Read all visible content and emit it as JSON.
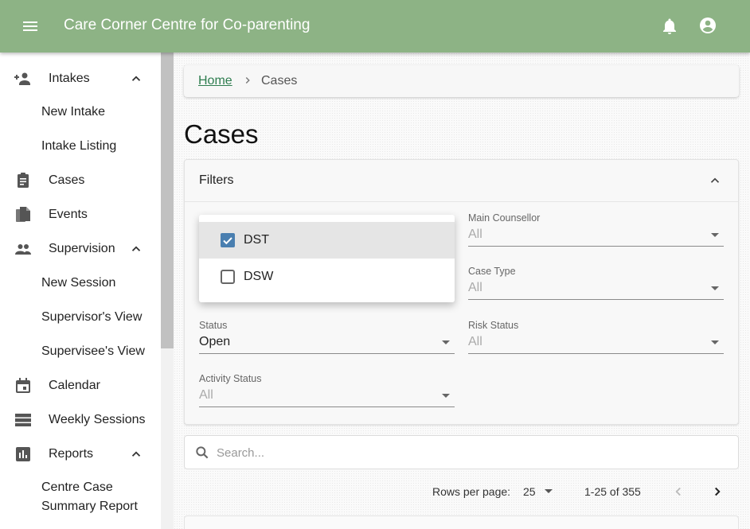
{
  "app": {
    "title": "Care Corner Centre for Co-parenting"
  },
  "icons": {
    "menu": "menu-icon",
    "notifications": "bell-icon",
    "account": "account-circle-icon",
    "search": "search-icon"
  },
  "colors": {
    "header": "#8db385",
    "link": "#2e7d4f"
  },
  "sidebar": {
    "items": [
      {
        "label": "Intakes",
        "icon": "person-add-icon",
        "expanded": true
      },
      {
        "label": "New Intake"
      },
      {
        "label": "Intake Listing"
      },
      {
        "label": "Cases",
        "icon": "clipboard-icon"
      },
      {
        "label": "Events",
        "icon": "file-copy-icon"
      },
      {
        "label": "Supervision",
        "icon": "people-icon",
        "expanded": true
      },
      {
        "label": "New Session"
      },
      {
        "label": "Supervisor's View"
      },
      {
        "label": "Supervisee's View"
      },
      {
        "label": "Calendar",
        "icon": "calendar-icon"
      },
      {
        "label": "Weekly Sessions",
        "icon": "view-week-icon"
      },
      {
        "label": "Reports",
        "icon": "bar-chart-icon",
        "expanded": true
      },
      {
        "label": "Centre Case Summary Report"
      }
    ],
    "report_sub_line1": "Centre Case",
    "report_sub_line2": "Summary Report"
  },
  "breadcrumb": {
    "home": "Home",
    "current": "Cases"
  },
  "page": {
    "title": "Cases"
  },
  "filters": {
    "header": "Filters",
    "dropdown_options": [
      {
        "label": "DST",
        "checked": true
      },
      {
        "label": "DSW",
        "checked": false
      }
    ],
    "main_counsellor": {
      "label": "Main Counsellor",
      "value": "All"
    },
    "case_type": {
      "label": "Case Type",
      "value": "All"
    },
    "status": {
      "label": "Status",
      "value": "Open"
    },
    "risk_status": {
      "label": "Risk Status",
      "value": "All"
    },
    "activity_status": {
      "label": "Activity Status",
      "value": "All"
    }
  },
  "search": {
    "placeholder": "Search..."
  },
  "pagination": {
    "rows_per_page_label": "Rows per page:",
    "rows_per_page": "25",
    "range": "1-25 of 355"
  }
}
